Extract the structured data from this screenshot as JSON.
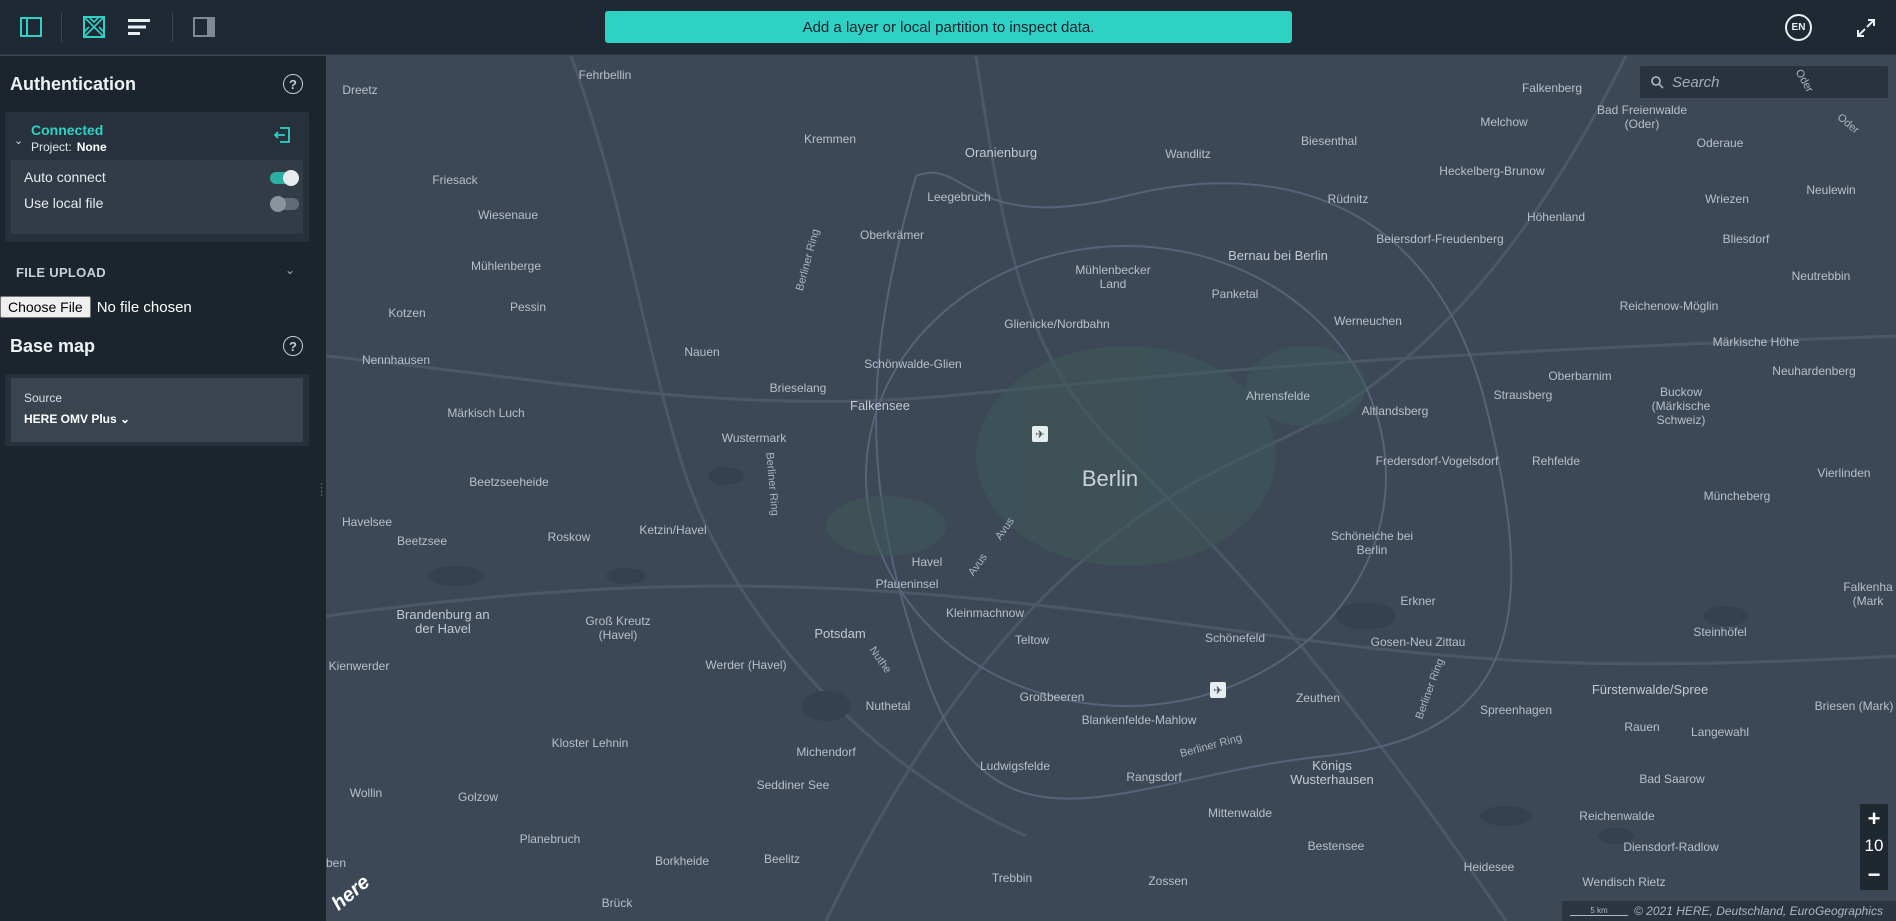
{
  "toolbar": {
    "notice": "Add a layer or local partition to inspect data.",
    "language": "EN"
  },
  "sidebar": {
    "authentication": {
      "heading": "Authentication",
      "status": "Connected",
      "project_label": "Project:",
      "project_value": "None",
      "options": [
        {
          "label": "Auto connect",
          "enabled": true
        },
        {
          "label": "Use local file",
          "enabled": false
        }
      ]
    },
    "file_upload": {
      "heading": "FILE UPLOAD",
      "button": "Choose File",
      "status": "No file chosen"
    },
    "base_map": {
      "heading": "Base map",
      "source_label": "Source",
      "source_value": "HERE OMV Plus"
    }
  },
  "map": {
    "search_placeholder": "Search",
    "zoom_in": "+",
    "zoom_level": "10",
    "zoom_out": "−",
    "scale": "5 km",
    "attribution": "© 2021 HERE, Deutschland, EuroGeographics",
    "logo": "here",
    "places": {
      "berlin": "Berlin",
      "potsdam": "Potsdam",
      "dreetz": "Dreetz",
      "fehrbellin": "Fehrbellin",
      "kremmen": "Kremmen",
      "oranienburg": "Oranienburg",
      "wandlitz": "Wandlitz",
      "biesenthal": "Biesenthal",
      "melchow": "Melchow",
      "falkenberg": "Falkenberg",
      "bad_freienwalde": "Bad Freienwalde\n(Oder)",
      "oderaue": "Oderaue",
      "neulewin": "Neulewin",
      "friesack": "Friesack",
      "leegebruch": "Leegebruch",
      "ruednitz": "Rüdnitz",
      "heckelberg": "Heckelberg-Brunow",
      "wriezen": "Wriezen",
      "wiesenaue": "Wiesenaue",
      "oberkraemer": "Oberkrämer",
      "hoehenland": "Höhenland",
      "beiersdorf": "Beiersdorf-Freudenberg",
      "bliesdorf": "Bliesdorf",
      "muehlenberge": "Mühlenberge",
      "muehlenbecker": "Mühlenbecker\nLand",
      "bernau": "Bernau bei Berlin",
      "neutrebbin": "Neutrebbin",
      "kotzen": "Kotzen",
      "pessin": "Pessin",
      "panketal": "Panketal",
      "glienicke": "Glienicke/Nordbahn",
      "werneuchen": "Werneuchen",
      "reichenow": "Reichenow-Möglin",
      "nennhausen": "Nennhausen",
      "nauen": "Nauen",
      "maerkische_hoehe": "Märkische Höhe",
      "schoenwalde": "Schönwalde-Glien",
      "oberbarnim": "Oberbarnim",
      "neuhardenberg": "Neuhardenberg",
      "brieselang": "Brieselang",
      "strausberg": "Strausberg",
      "buckow": "Buckow\n(Märkische\nSchweiz)",
      "maerkisch_luch": "Märkisch Luch",
      "falkensee": "Falkensee",
      "ahrensfelde": "Ahrensfelde",
      "altlandsberg": "Altlandsberg",
      "wustermark": "Wustermark",
      "fredersdorf": "Fredersdorf-Vogelsdorf",
      "rehfelde": "Rehfelde",
      "vierlinden": "Vierlinden",
      "beetzseeheide": "Beetzseeheide",
      "muencheberg": "Müncheberg",
      "havelsee": "Havelsee",
      "roskow": "Roskow",
      "ketzin": "Ketzin/Havel",
      "schoeneiche": "Schöneiche bei\nBerlin",
      "beetzsee": "Beetzsee",
      "havel": "Havel",
      "pfaueninsel": "Pfaueninsel",
      "falkenhagen": "Falkenha\n(Mark",
      "erkner": "Erkner",
      "brandenburg": "Brandenburg an\nder Havel",
      "gross_kreutz": "Groß Kreutz\n(Havel)",
      "kleinmachnow": "Kleinmachnow",
      "steinhoefel": "Steinhöfel",
      "schoenefeld": "Schönefeld",
      "gosen": "Gosen-Neu Zittau",
      "teltow": "Teltow",
      "werder": "Werder (Havel)",
      "kienwerder": "Kienwerder",
      "fuerstenwalde": "Fürstenwalde/Spree",
      "zeuthen": "Zeuthen",
      "spreenhagen": "Spreenhagen",
      "briesen": "Briesen (Mark)",
      "nuthetal": "Nuthetal",
      "grossbeeren": "Großbeeren",
      "rauen": "Rauen",
      "langewahl": "Langewahl",
      "blankenfelde": "Blankenfelde-Mahlow",
      "kloster_lehnin": "Kloster Lehnin",
      "michendorf": "Michendorf",
      "koenigs": "Königs\nWusterhausen",
      "ludwigsfelde": "Ludwigsfelde",
      "rangsdorf": "Rangsdorf",
      "seddiner_see": "Seddiner See",
      "bad_saarow": "Bad Saarow",
      "wollin": "Wollin",
      "golzow": "Golzow",
      "mittenwalde": "Mittenwalde",
      "reichenwalde": "Reichenwalde",
      "planebruch": "Planebruch",
      "bestensee": "Bestensee",
      "diensdorf": "Diensdorf-Radlow",
      "borkheide": "Borkheide",
      "beelitz": "Beelitz",
      "heidesee": "Heidesee",
      "trebbin": "Trebbin",
      "zossen": "Zossen",
      "wendisch_rietz": "Wendisch Rietz",
      "brueck": "Brück",
      "ben": "ben",
      "oder": "Oder",
      "oder2": "Oder"
    },
    "roads": {
      "berliner_ring_nw": "Berliner Ring",
      "berliner_ring_w": "Berliner Ring",
      "berliner_ring_s": "Berliner Ring",
      "berliner_ring_se": "Berliner Ring",
      "avus1": "Avus",
      "avus2": "Avus",
      "nuthe": "Nuthe"
    }
  }
}
